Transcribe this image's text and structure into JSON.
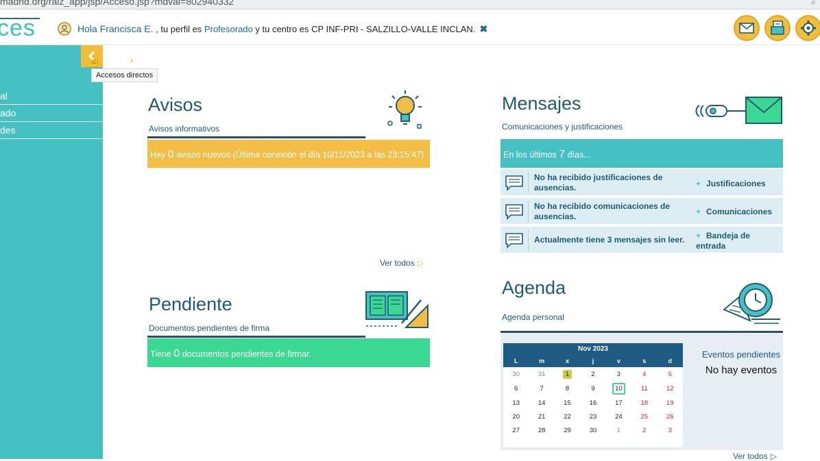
{
  "browser": {
    "url": "madrid.org/raiz_app/jsp/Acceso.jsp?mdval=802940332"
  },
  "header": {
    "logo": "ces",
    "greeting_hola": "Hola Francisca E.",
    "greeting_mid": ", tu perfil es",
    "profile": "Profesorado",
    "greeting_center_prefix": "y tu centro es",
    "center": "CP INF-PRI - SALZILLO-VALLE INCLAN.",
    "close_symbol": "✖",
    "buttons": [
      "mail-icon",
      "documents-icon",
      "settings-icon"
    ]
  },
  "sidebar": {
    "items": [
      {
        "label": "al"
      },
      {
        "label": "ado"
      },
      {
        "label": "des"
      }
    ],
    "toggle_tooltip": "Accesos directos",
    "accent": "#45c0c3"
  },
  "avisos": {
    "title": "Avisos",
    "subtitle": "Avisos informativos",
    "bar_prefix": "Hay",
    "count": "0",
    "bar_suffix": "avisos nuevos (Última conexión el día 10/11/2023 a las 23:15:47)",
    "ver_todos": "Ver todos",
    "color": "#f4bd46"
  },
  "pendiente": {
    "title": "Pendiente",
    "subtitle": "Documentos pendientes de firma",
    "bar_prefix": "Tiene",
    "count": "0",
    "bar_suffix": "documentos pendientes de firmar.",
    "color": "#3bd893"
  },
  "mensajes": {
    "title": "Mensajes",
    "subtitle": "Comunicaciones y justificaciones",
    "bar_prefix": "En los últimos",
    "days": "7",
    "bar_suffix": "días...",
    "rows": [
      {
        "text": "No ha recibido justificaciones de ausencias.",
        "link": "Justificaciones"
      },
      {
        "text": "No ha recibido comunicaciones de ausencias.",
        "link": "Comunicaciones"
      },
      {
        "text": "Actualmente tiene 3 mensajes sin leer.",
        "link": "Bandeja de entrada"
      }
    ],
    "plus": "+"
  },
  "agenda": {
    "title": "Agenda",
    "subtitle": "Agenda personal",
    "month": "Nov 2023",
    "weekdays": [
      "L",
      "m",
      "x",
      "j",
      "v",
      "s",
      "d"
    ],
    "weeks": [
      [
        "30",
        "31",
        "1",
        "2",
        "3",
        "4",
        "5"
      ],
      [
        "6",
        "7",
        "8",
        "9",
        "10",
        "11",
        "12"
      ],
      [
        "13",
        "14",
        "15",
        "16",
        "17",
        "18",
        "19"
      ],
      [
        "20",
        "21",
        "22",
        "23",
        "24",
        "25",
        "26"
      ],
      [
        "27",
        "28",
        "29",
        "30",
        "1",
        "2",
        "3"
      ]
    ],
    "events_title": "Eventos pendientes",
    "events_empty": "No hay eventos",
    "ver_todos": "Ver todos"
  }
}
